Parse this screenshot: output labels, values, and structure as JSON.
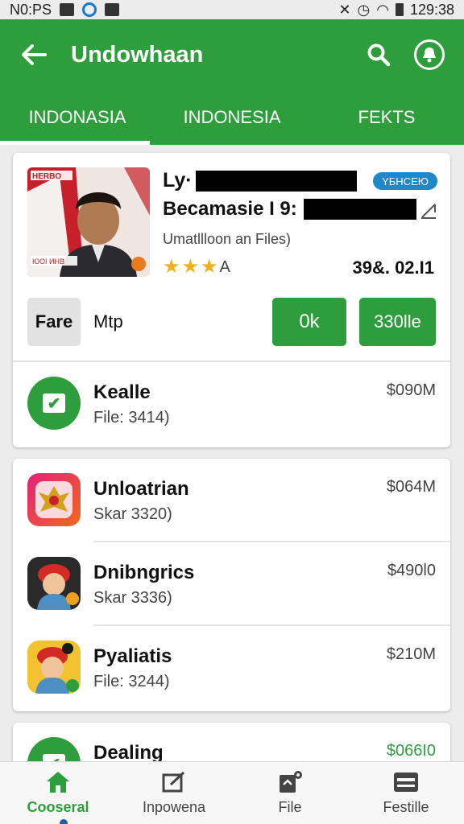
{
  "status_bar": {
    "left_text": "N0:PS",
    "time": "129:38"
  },
  "appbar": {
    "title": "Undowhaan"
  },
  "tabs": [
    {
      "label": "INDONASIA",
      "active": true
    },
    {
      "label": "INDONESIA",
      "active": false
    },
    {
      "label": "FEKTS",
      "active": false
    }
  ],
  "featured": {
    "image_banner": "HERBO",
    "image_caption": "ЮОІ ИНВ",
    "line1_prefix": "Ly·",
    "line2_prefix": "Becamasie I 9:",
    "badge": "YБНСЕЮ",
    "subtitle": "Umatllloon an Files)",
    "rating_stars": 3,
    "rating_suffix": "A",
    "price": "39&. 02.I1",
    "buttons": {
      "fare": "Fare",
      "mtp": "Mtp",
      "ok": "0k",
      "second": "330lle"
    }
  },
  "featured_row": {
    "title": "Kealle",
    "sub": "File: 3414)",
    "price": "$090M"
  },
  "list": [
    {
      "title": "Unloatrian",
      "sub": "Skar 3320)",
      "price": "$064M",
      "icon": "emblem-icon"
    },
    {
      "title": "Dnibngrics",
      "sub": "Skar 3336)",
      "price": "$490l0",
      "icon": "worker-avatar-icon"
    },
    {
      "title": "Pyaliatis",
      "sub": "File: 3244)",
      "price": "$210M",
      "icon": "worker-avatar-icon"
    }
  ],
  "partial_row": {
    "title": "Dealing",
    "price": "$066I0"
  },
  "bottom_nav": [
    {
      "label": "Cooseral",
      "active": true,
      "icon": "home-icon"
    },
    {
      "label": "Inpowena",
      "active": false,
      "icon": "edit-box-icon"
    },
    {
      "label": "File",
      "active": false,
      "icon": "file-notify-icon"
    },
    {
      "label": "Festille",
      "active": false,
      "icon": "card-icon"
    }
  ],
  "colors": {
    "primary": "#2e9e3d",
    "badge": "#1e88c8",
    "star": "#f2b01e"
  }
}
